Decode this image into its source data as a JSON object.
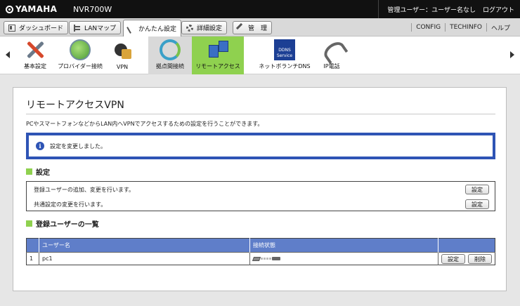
{
  "header": {
    "brand": "YAMAHA",
    "model": "NVR700W",
    "user_label": "管理ユーザー：ユーザー名なし",
    "logout": "ログアウト"
  },
  "menubar": {
    "tabs": [
      {
        "label": "ダッシュボード",
        "icon": "dashboard-icon",
        "active": false
      },
      {
        "label": "LANマップ",
        "icon": "lan-map-icon",
        "active": false
      },
      {
        "label": "かんたん設定",
        "icon": "wand-icon",
        "active": true
      },
      {
        "label": "詳細設定",
        "icon": "gear-icon",
        "active": false
      },
      {
        "label": "管　理",
        "icon": "tool-icon",
        "active": false
      }
    ],
    "links": [
      "CONFIG",
      "TECHINFO",
      "ヘルプ"
    ]
  },
  "iconnav": {
    "items": [
      {
        "label": "基本設定",
        "icon": "tools-icon"
      },
      {
        "label": "プロバイダー接続",
        "icon": "globe-icon"
      },
      {
        "label": "VPN",
        "icon": "vpn-lock-icon"
      },
      {
        "label": "拠点間接続",
        "icon": "site-connect-icon"
      },
      {
        "label": "リモートアクセス",
        "icon": "remote-access-icon",
        "selected": true
      },
      {
        "label": "ネットボランチDNS",
        "icon": "ddns-icon",
        "badge": "DDNS Service"
      },
      {
        "label": "IP電話",
        "icon": "phone-icon"
      }
    ]
  },
  "main": {
    "title": "リモートアクセスVPN",
    "intro": "PCやスマートフォンなどからLAN内へVPNでアクセスするための設定を行うことができます。",
    "notice": "設定を変更しました。",
    "settings_heading": "設定",
    "settings_rows": [
      {
        "text": "登録ユーザーの追加、変更を行います。",
        "button": "設定"
      },
      {
        "text": "共通設定の変更を行います。",
        "button": "設定"
      }
    ],
    "users_heading": "登録ユーザーの一覧",
    "table": {
      "columns": [
        "",
        "ユーザー名",
        "接続状態",
        ""
      ],
      "rows": [
        {
          "no": "1",
          "name": "pc1",
          "status_icon": "connection-status-icon",
          "edit": "設定",
          "delete": "削除"
        }
      ]
    }
  },
  "colors": {
    "accent_green": "#8fd14f",
    "notice_blue": "#2e54b5",
    "table_header": "#5f7ec9"
  }
}
